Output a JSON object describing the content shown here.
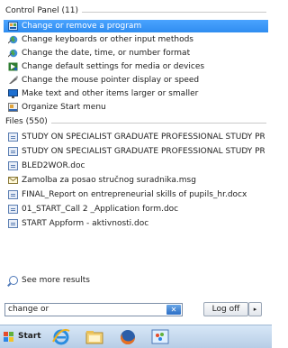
{
  "control_panel": {
    "header": "Control Panel (11)",
    "items": [
      {
        "label": "Change or remove a program",
        "icon": "programs-icon"
      },
      {
        "label": "Change keyboards or other input methods",
        "icon": "region-globe-icon"
      },
      {
        "label": "Change the date, time, or number format",
        "icon": "region-globe-icon"
      },
      {
        "label": "Change default settings for media or devices",
        "icon": "autoplay-icon"
      },
      {
        "label": "Change the mouse pointer display or speed",
        "icon": "mouse-pointer-icon"
      },
      {
        "label": "Make text and other items larger or smaller",
        "icon": "display-icon"
      },
      {
        "label": "Organize Start menu",
        "icon": "taskbar-start-icon"
      }
    ]
  },
  "files": {
    "header": "Files (550)",
    "items": [
      {
        "label": "STUDY ON SPECIALIST GRADUATE PROFESSIONAL STUDY PROG...",
        "icon": "word-document-icon"
      },
      {
        "label": "STUDY ON SPECIALIST GRADUATE PROFESSIONAL STUDY PROG...",
        "icon": "word-document-icon"
      },
      {
        "label": "BLED2WOR.doc",
        "icon": "word-document-icon"
      },
      {
        "label": "Zamolba za posao stručnog suradnika.msg",
        "icon": "mail-message-icon"
      },
      {
        "label": "FINAL_Report on entrepreneurial skills of pupils_hr.docx",
        "icon": "word-document-icon"
      },
      {
        "label": "01_START_Call 2 _Application form.doc",
        "icon": "word-document-icon"
      },
      {
        "label": "START Appform - aktivnosti.doc",
        "icon": "word-document-icon"
      }
    ]
  },
  "see_more": "See more results",
  "search": {
    "value": "change or",
    "clear_icon": "clear-search-icon"
  },
  "logoff": {
    "label": "Log off",
    "arrow": "▸"
  },
  "taskbar": {
    "start_label": "Start",
    "pinned": [
      "internet-explorer-icon",
      "file-explorer-icon",
      "firefox-icon",
      "paint-icon"
    ]
  },
  "colors": {
    "selected": "#3399ff",
    "accent": "#2b6ec6"
  }
}
